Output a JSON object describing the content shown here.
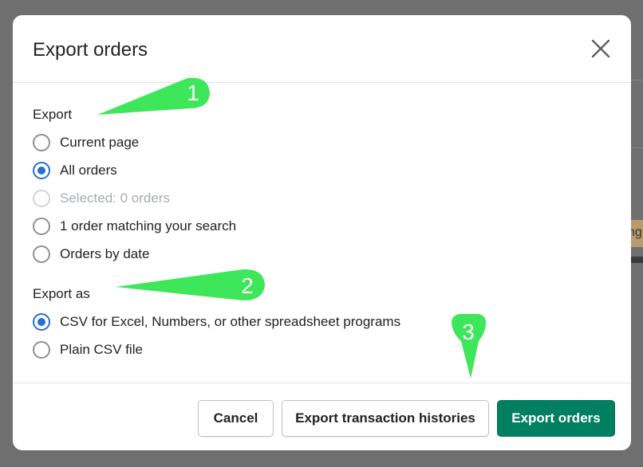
{
  "background": {
    "partial_text": "ng"
  },
  "modal": {
    "title": "Export orders",
    "close_label": "Close"
  },
  "export_section": {
    "label": "Export",
    "options": [
      {
        "label": "Current page",
        "checked": false,
        "disabled": false
      },
      {
        "label": "All orders",
        "checked": true,
        "disabled": false
      },
      {
        "label": "Selected: 0 orders",
        "checked": false,
        "disabled": true
      },
      {
        "label": "1 order matching your search",
        "checked": false,
        "disabled": false
      },
      {
        "label": "Orders by date",
        "checked": false,
        "disabled": false
      }
    ]
  },
  "export_as_section": {
    "label": "Export as",
    "options": [
      {
        "label": "CSV for Excel, Numbers, or other spreadsheet programs",
        "checked": true,
        "disabled": false
      },
      {
        "label": "Plain CSV file",
        "checked": false,
        "disabled": false
      }
    ]
  },
  "footer": {
    "cancel_label": "Cancel",
    "history_label": "Export transaction histories",
    "export_label": "Export orders"
  },
  "callouts": [
    {
      "number": "1"
    },
    {
      "number": "2"
    },
    {
      "number": "3"
    }
  ],
  "colors": {
    "primary_green": "#008060",
    "radio_blue": "#2c6ecb",
    "callout_green": "#3ee65a",
    "overlay": "#6f6f6f"
  }
}
